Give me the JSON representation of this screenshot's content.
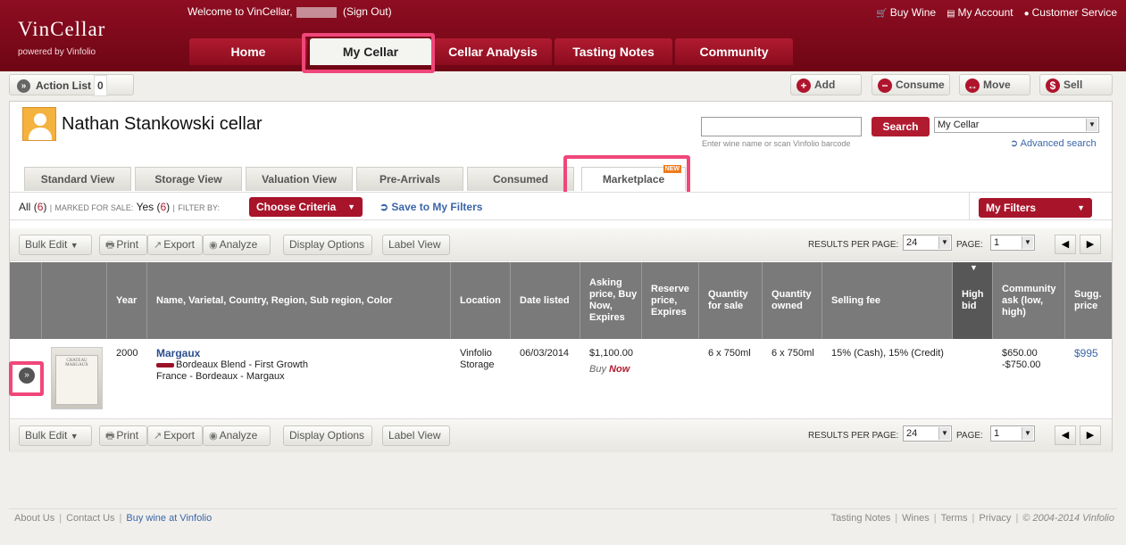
{
  "header": {
    "logo": "VinCellar",
    "logo_sub": "powered by Vinfolio",
    "welcome": "Welcome to VinCellar,",
    "sign_out": "(Sign Out)",
    "top_links": [
      "Buy Wine",
      "My Account",
      "Customer Service"
    ],
    "nav_tabs": [
      "Home",
      "My Cellar",
      "Cellar Analysis",
      "Tasting Notes",
      "Community"
    ]
  },
  "action_bar": {
    "action_list": "Action List",
    "action_count": "0",
    "buttons": [
      "Add",
      "Consume",
      "Move",
      "Sell"
    ]
  },
  "cellar": {
    "title": "Nathan Stankowski cellar",
    "search_button": "Search",
    "search_hint": "Enter wine name or scan Vinfolio barcode",
    "cellar_select": "My Cellar",
    "advanced_search": "Advanced search"
  },
  "view_tabs": [
    "Standard View",
    "Storage View",
    "Valuation View",
    "Pre-Arrivals",
    "Consumed",
    "Marketplace"
  ],
  "new_badge": "NEW",
  "filters": {
    "all_label": "All",
    "all_count": "6",
    "marked_label": "MARKED FOR SALE:",
    "marked_value": "Yes",
    "marked_count": "6",
    "filter_by": "FILTER BY:",
    "choose_criteria": "Choose Criteria",
    "save_filters": "Save to My Filters",
    "my_filters": "My Filters"
  },
  "toolbar": {
    "bulk_edit": "Bulk Edit",
    "print": "Print",
    "export": "Export",
    "analyze": "Analyze",
    "display_options": "Display Options",
    "label_view": "Label View",
    "results_label": "RESULTS PER PAGE:",
    "results_value": "24",
    "page_label": "PAGE:",
    "page_value": "1"
  },
  "table": {
    "headers": [
      "Year",
      "Name, Varietal, Country, Region, Sub region, Color",
      "Location",
      "Date listed",
      "Asking price, Buy Now, Expires",
      "Reserve price, Expires",
      "Quantity for sale",
      "Quantity owned",
      "Selling fee",
      "High bid",
      "Community ask (low, high)",
      "Sugg. price"
    ],
    "row": {
      "year": "2000",
      "name": "Margaux",
      "varietal": "Bordeaux Blend - First Growth",
      "region": "France - Bordeaux - Margaux",
      "location": "Vinfolio Storage",
      "date_listed": "06/03/2014",
      "asking_price": "$1,100.00",
      "buy_prefix": "Buy",
      "buy_now": "Now",
      "qty_sale": "6 x 750ml",
      "qty_owned": "6 x 750ml",
      "fee": "15% (Cash), 15% (Credit)",
      "community": "$650.00 -$750.00",
      "sugg_price": "$995",
      "bottle_label": "CHATEAU MARGAUX"
    }
  },
  "footer": {
    "left": [
      "About Us",
      "Contact Us",
      "Buy wine at Vinfolio"
    ],
    "right": [
      "Tasting Notes",
      "Wines",
      "Terms",
      "Privacy"
    ],
    "copyright": "© 2004-2014 Vinfolio"
  },
  "colors": {
    "brand": "#8e0d21",
    "highlight": "#f0477a",
    "link": "#3b66a8"
  }
}
